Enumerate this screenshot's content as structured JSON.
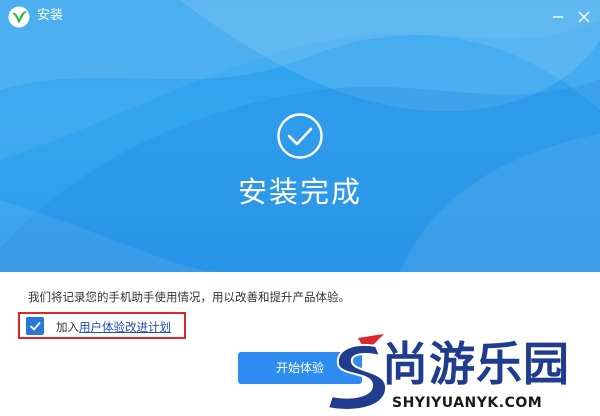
{
  "window": {
    "title": "安装"
  },
  "hero": {
    "status_title": "安装完成"
  },
  "content": {
    "description": "我们将记录您的手机助手使用情况，用以改善和提升产品体验。",
    "plan_prefix": "加入",
    "plan_link": "用户体验改进计划",
    "plan_checked": true,
    "start_button": "开始体验"
  },
  "watermark": {
    "text": "尚游乐园",
    "url": "SHYIYUANYK.COM"
  },
  "colors": {
    "hero": "#2aa0ee",
    "button": "#2d8cf0",
    "checkbox": "#2776d9",
    "highlight_border": "#e0262b",
    "link": "#1d4fb5"
  },
  "icons": [
    "app-logo-icon",
    "minimize-icon",
    "close-icon",
    "check-circle-icon",
    "checkbox-check-icon"
  ]
}
